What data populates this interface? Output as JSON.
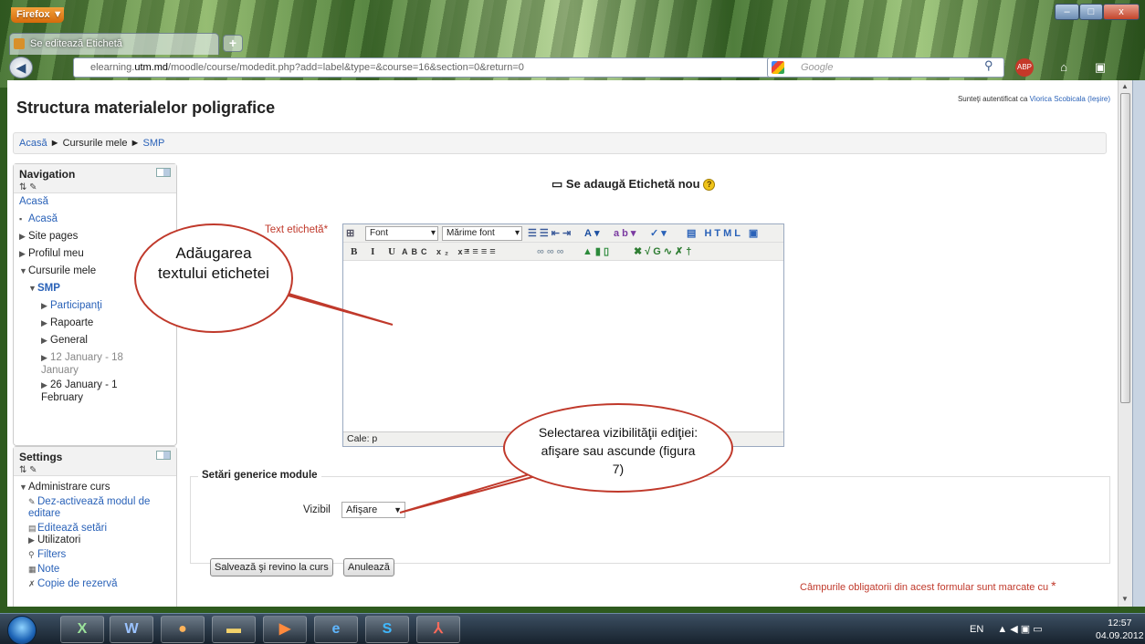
{
  "browser": {
    "menu_label": "Firefox ▼",
    "tab_title": "Se editează Etichetă",
    "new_tab": "+",
    "url_prefix": "elearning.",
    "url_domain": "utm.md",
    "url_rest": "/moodle/course/modedit.php?add=label&type=&course=16&section=0&return=0",
    "search_placeholder": "Google",
    "win_min": "–",
    "win_max": "□",
    "win_close": "x"
  },
  "page": {
    "site_title": "Structura materialelor poligrafice",
    "login_prefix": "Sunteţi autentificat ca ",
    "login_user": "Viorica Scobicala",
    "login_exit": " (Ieşire)",
    "breadcrumb": {
      "home": "Acasă",
      "sep": " ► ",
      "courses": "Cursurile mele",
      "course": "SMP"
    },
    "heading": "Se adaugă Etichetă nou",
    "text_label": "Text etichetă",
    "required_mark": "*",
    "editor": {
      "font_select": "Font",
      "size_select": "Mărime font",
      "path": "Cale: p"
    },
    "fieldset_legend": "Setări generice module",
    "visible_label": "Vizibil",
    "visible_value": "Afişare",
    "save_button": "Salvează şi revino la curs",
    "cancel_button": "Anulează",
    "footnote": "Câmpurile obligatorii din acest formular sunt marcate cu "
  },
  "navigation": {
    "title": "Navigation",
    "root": "Acasă",
    "items": [
      "Acasă",
      "Site pages",
      "Profilul meu",
      "Cursurile mele",
      "SMP",
      "Participanţi",
      "Rapoarte",
      "General",
      "12 January - 18 January",
      "26 January - 1 February"
    ]
  },
  "settings": {
    "title": "Settings",
    "items": [
      "Administrare curs",
      "Dez-activează modul de editare",
      "Editează setări",
      "Utilizatori",
      "Filters",
      "Note",
      "Copie de rezervă"
    ]
  },
  "annotations": {
    "bubble1": "Adăugarea textului etichetei",
    "bubble2": "Selectarea vizibilităţii ediţiei: afişare sau ascunde (figura 7)"
  },
  "taskbar": {
    "lang": "EN",
    "time": "12:57",
    "date": "04.09.2012"
  },
  "colors": {
    "accent": "#2a62b8",
    "required": "#c0392b",
    "callout_border": "#c0392b"
  }
}
